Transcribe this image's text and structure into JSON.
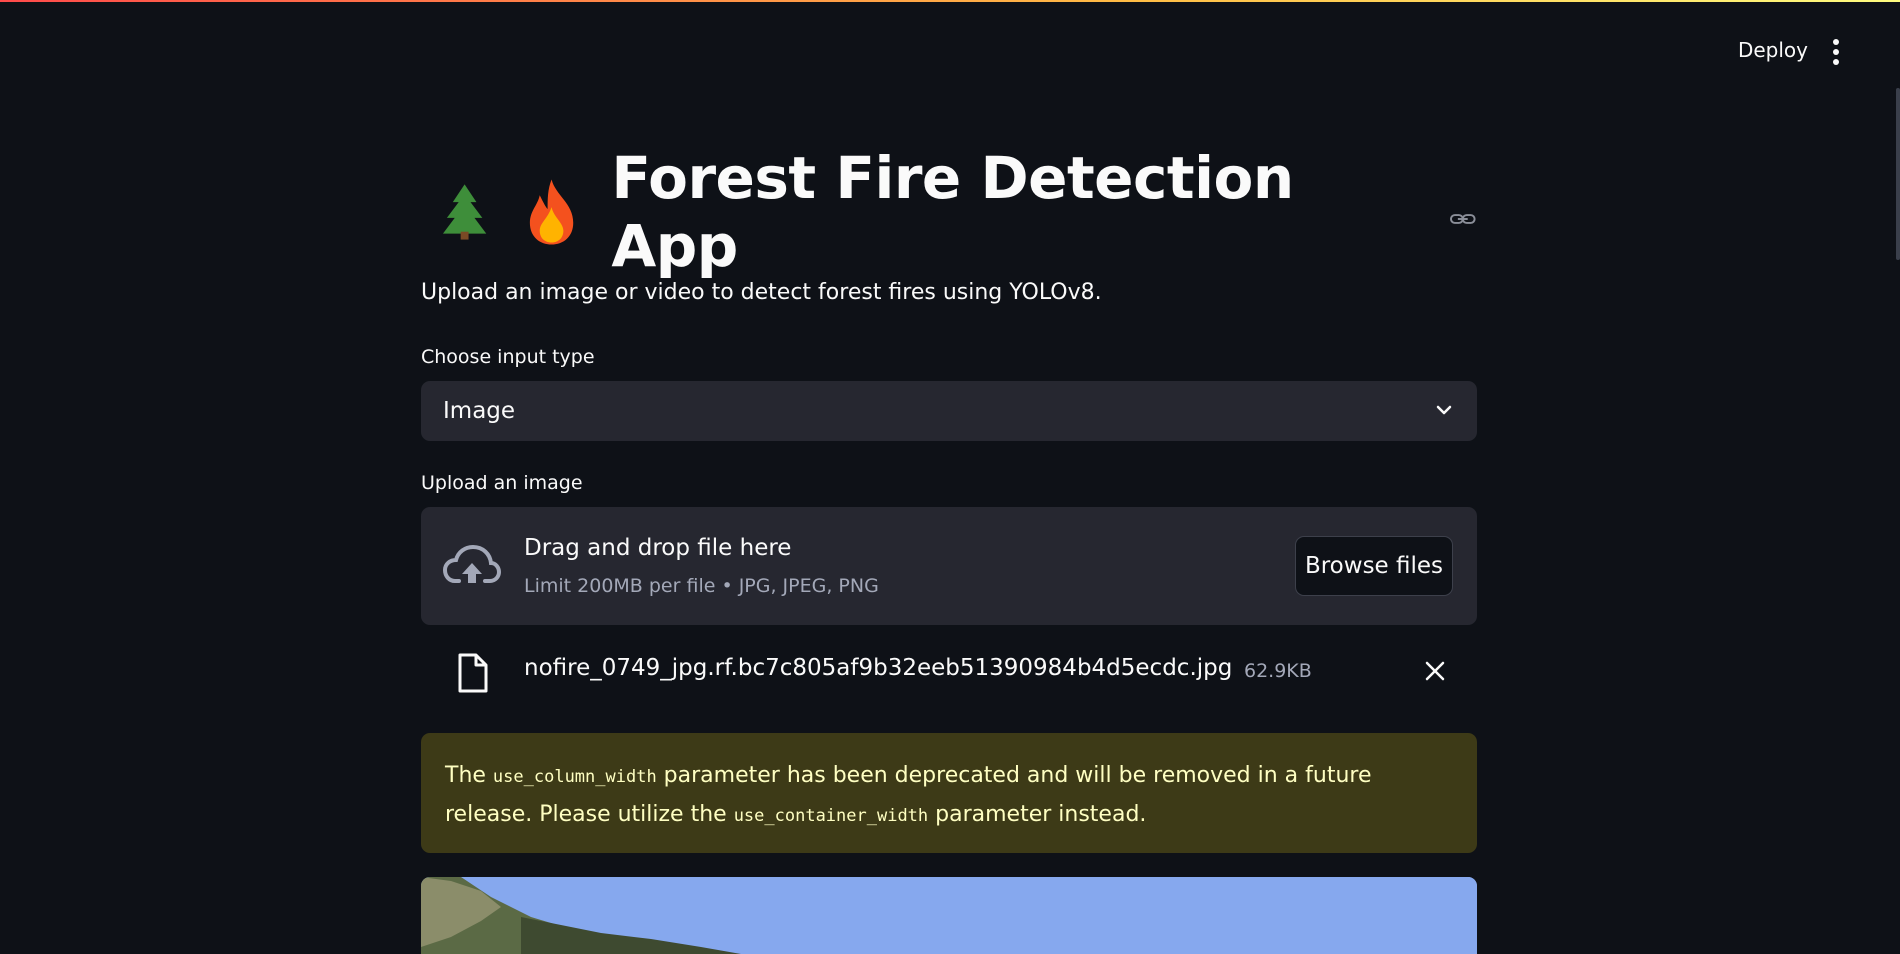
{
  "header": {
    "deploy_label": "Deploy",
    "menu_icon": "kebab-menu-icon"
  },
  "app": {
    "title": "Forest Fire Detection App",
    "title_icons": [
      "evergreen-tree-icon",
      "fire-icon"
    ],
    "subtitle": "Upload an image or video to detect forest fires using YOLOv8."
  },
  "input_type": {
    "label": "Choose input type",
    "selected": "Image"
  },
  "uploader": {
    "label": "Upload an image",
    "drop_text": "Drag and drop file here",
    "limit_text": "Limit 200MB per file • JPG, JPEG, PNG",
    "browse_label": "Browse files"
  },
  "uploaded_file": {
    "name": "nofire_0749_jpg.rf.bc7c805af9b32eeb51390984b4d5ecdc.jpg",
    "size": "62.9KB"
  },
  "warning": {
    "part1": "The ",
    "code1": "use_column_width",
    "part2": " parameter has been deprecated and will be removed in a future release. Please utilize the ",
    "code2": "use_container_width",
    "part3": " parameter instead."
  },
  "colors": {
    "background": "#0e1117",
    "widget": "#262730",
    "warning_bg": "#3d3a17",
    "warning_text": "#ffffc2"
  }
}
